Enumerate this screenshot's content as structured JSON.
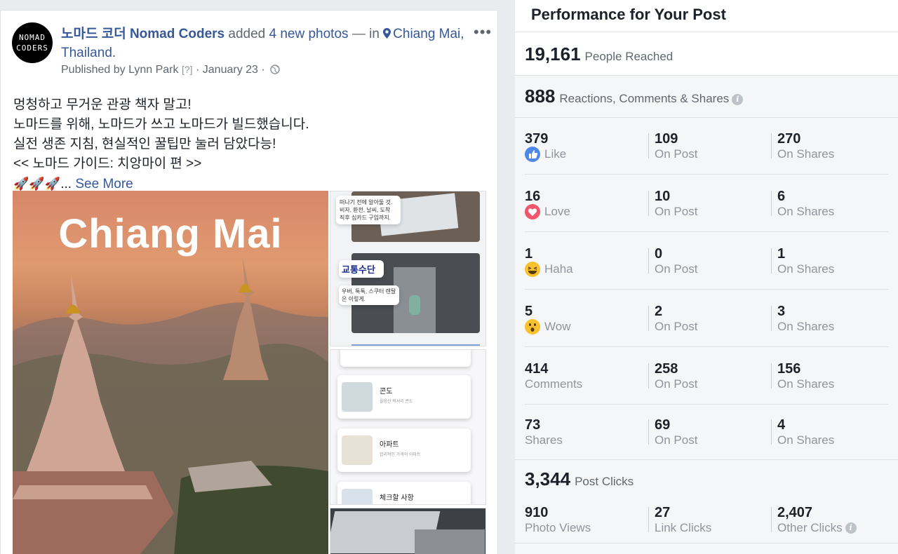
{
  "post": {
    "avatar_line1": "NOMAD",
    "avatar_line2": "CODERS",
    "page_name": "노마드 코더 Nomad Coders",
    "action_text": "added",
    "photos_link": "4 new photos",
    "in_text": "— in",
    "location": "Chiang Mai, Thailand.",
    "published_by": "Published by Lynn Park",
    "help_mark": "[?]",
    "dot": "·",
    "date": "January 23",
    "body_lines": [
      "멍청하고 무거운 관광 책자 말고!",
      "노마드를 위해, 노마드가 쓰고 노마드가 빌드했습니다.",
      "실전 생존 지침, 현실적인 꿀팁만 눌러 담았다능!",
      "<< 노마드 가이드: 치앙마이 편 >>"
    ],
    "rockets": "🚀🚀🚀",
    "ellipsis": "...",
    "see_more": "See More",
    "photo_main_title": "Chiang Mai",
    "thumb1_text": "떠나기 전에 알아둘 것.\n비자, 환전, 날씨, 도착\n직후 심카드 구입까지.",
    "thumb1_heading": "교통수단",
    "thumb1_sub": "우버, 툭툭, 스쿠터 렌탈\n은 이렇게.",
    "thumb2_items": [
      {
        "title": "콘도",
        "sub": "올음산 럭셔리 콘도"
      },
      {
        "title": "아파트",
        "sub": "합리적인 가격의 아파트"
      },
      {
        "title": "체크할 사항",
        "sub": ""
      }
    ]
  },
  "performance": {
    "title": "Performance for Your Post",
    "people_reached": {
      "value": "19,161",
      "label": "People Reached"
    },
    "engagement": {
      "value": "888",
      "label": "Reactions, Comments & Shares"
    },
    "rows": [
      {
        "total": "379",
        "label": "Like",
        "icon": "like-icon",
        "on_post": "109",
        "on_shares": "270"
      },
      {
        "total": "16",
        "label": "Love",
        "icon": "love-icon",
        "on_post": "10",
        "on_shares": "6"
      },
      {
        "total": "1",
        "label": "Haha",
        "icon": "haha-icon",
        "on_post": "0",
        "on_shares": "1"
      },
      {
        "total": "5",
        "label": "Wow",
        "icon": "wow-icon",
        "on_post": "2",
        "on_shares": "3"
      },
      {
        "total": "414",
        "label": "Comments",
        "icon": "",
        "on_post": "258",
        "on_shares": "156"
      },
      {
        "total": "73",
        "label": "Shares",
        "icon": "",
        "on_post": "69",
        "on_shares": "4"
      }
    ],
    "on_post_label": "On Post",
    "on_shares_label": "On Shares",
    "post_clicks": {
      "value": "3,344",
      "label": "Post Clicks"
    },
    "clicks": [
      {
        "value": "910",
        "label": "Photo Views"
      },
      {
        "value": "27",
        "label": "Link Clicks"
      },
      {
        "value": "2,407",
        "label": "Other Clicks"
      }
    ]
  },
  "colors": {
    "link": "#365899",
    "like": "#4e88e8",
    "love": "#f0556b",
    "haha": "#f7c12f"
  }
}
